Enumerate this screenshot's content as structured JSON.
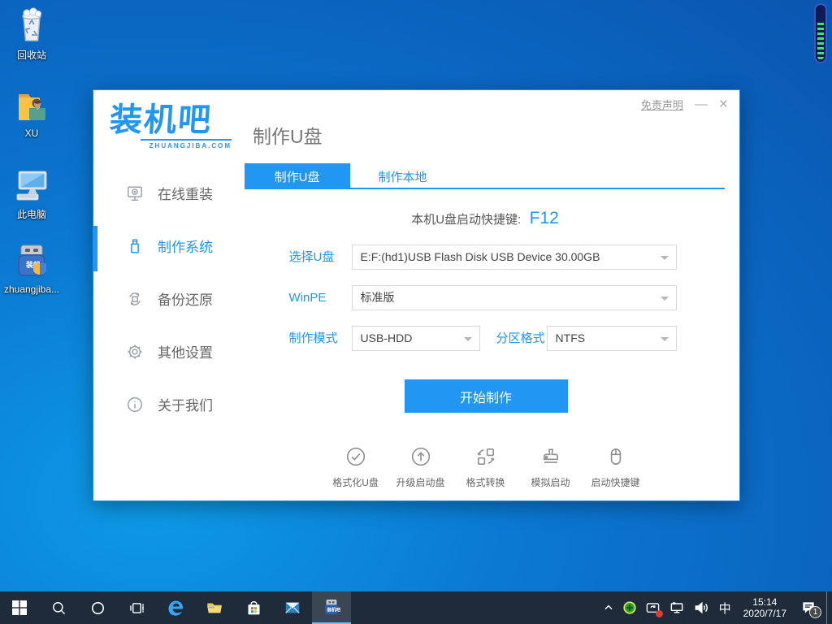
{
  "colors": {
    "accent": "#2196f3",
    "desktop_blue": "#0b78d2",
    "taskbar_bg": "#1d2b3a",
    "sidebar_text": "#666666",
    "meter_green": "#46e06a"
  },
  "desktop": {
    "icons": [
      {
        "label": "回收站",
        "icon": "recycle-bin-icon"
      },
      {
        "label": "XU",
        "icon": "user-folder-icon"
      },
      {
        "label": "此电脑",
        "icon": "this-pc-icon"
      },
      {
        "label": "zhuangjiba...",
        "icon": "zhuangjiba-app-icon"
      }
    ]
  },
  "window": {
    "logo": {
      "text": "装机吧",
      "sub": "ZHUANGJIBA.COM"
    },
    "header": {
      "title": "制作U盘",
      "disclaimer": "免责声明",
      "minimize": "—",
      "close": "×"
    },
    "sidebar": {
      "items": [
        {
          "label": "在线重装",
          "icon": "monitor-reinstall-icon",
          "active": false
        },
        {
          "label": "制作系统",
          "icon": "usb-drive-icon",
          "active": true
        },
        {
          "label": "备份还原",
          "icon": "backup-restore-icon",
          "active": false
        },
        {
          "label": "其他设置",
          "icon": "gear-icon",
          "active": false
        },
        {
          "label": "关于我们",
          "icon": "info-icon",
          "active": false
        }
      ]
    },
    "tabs": [
      {
        "label": "制作U盘",
        "active": true
      },
      {
        "label": "制作本地",
        "active": false
      }
    ],
    "hotkey": {
      "label": "本机U盘启动快捷键:",
      "value": "F12"
    },
    "form": {
      "usb": {
        "label": "选择U盘",
        "value": "E:F:(hd1)USB Flash Disk USB Device 30.00GB"
      },
      "winpe": {
        "label": "WinPE",
        "value": "标准版"
      },
      "mode": {
        "label": "制作模式",
        "value": "USB-HDD"
      },
      "partition": {
        "label": "分区格式",
        "value": "NTFS"
      }
    },
    "start_button": "开始制作",
    "tools": [
      {
        "label": "格式化U盘",
        "icon": "check-circle-icon"
      },
      {
        "label": "升级启动盘",
        "icon": "arrow-up-circle-icon"
      },
      {
        "label": "格式转换",
        "icon": "convert-icon"
      },
      {
        "label": "模拟启动",
        "icon": "stamp-icon"
      },
      {
        "label": "启动快捷键",
        "icon": "mouse-icon"
      }
    ]
  },
  "taskbar": {
    "tray": {
      "ime": "中",
      "time": "15:14",
      "date": "2020/7/17",
      "badge": "1"
    }
  }
}
